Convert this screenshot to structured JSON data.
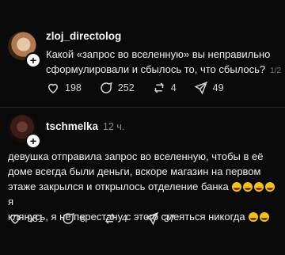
{
  "posts": [
    {
      "username": "zloj_directolog",
      "time": "",
      "text_line1": "Какой «запрос во вселенную» вы неправильно",
      "text_line2": "сформулировали и сбылось то, что сбылось?",
      "pager": "1/2",
      "likes": "198",
      "comments": "252",
      "reposts": "4",
      "shares": "49"
    },
    {
      "username": "tschmelka",
      "time": "12 ч.",
      "text_line1": "девушка отправила запрос во вселенную, чтобы в её",
      "text_line2": "доме всегда были деньги, вскоре магазин на первом",
      "text_line3": "этаже закрылся и открылось отделение банка",
      "text_line3b": "я",
      "text_line4": "клянусь, я не перестану с этого смеяться никогда",
      "likes": "981",
      "comments": "8",
      "reposts": "4",
      "shares": "37"
    }
  ],
  "icons": {
    "avatar_badge": "+",
    "like": "heart-icon",
    "comment": "comment-icon",
    "repost": "repost-icon",
    "share": "send-icon",
    "emoji": "laughing-emoji-icon"
  }
}
